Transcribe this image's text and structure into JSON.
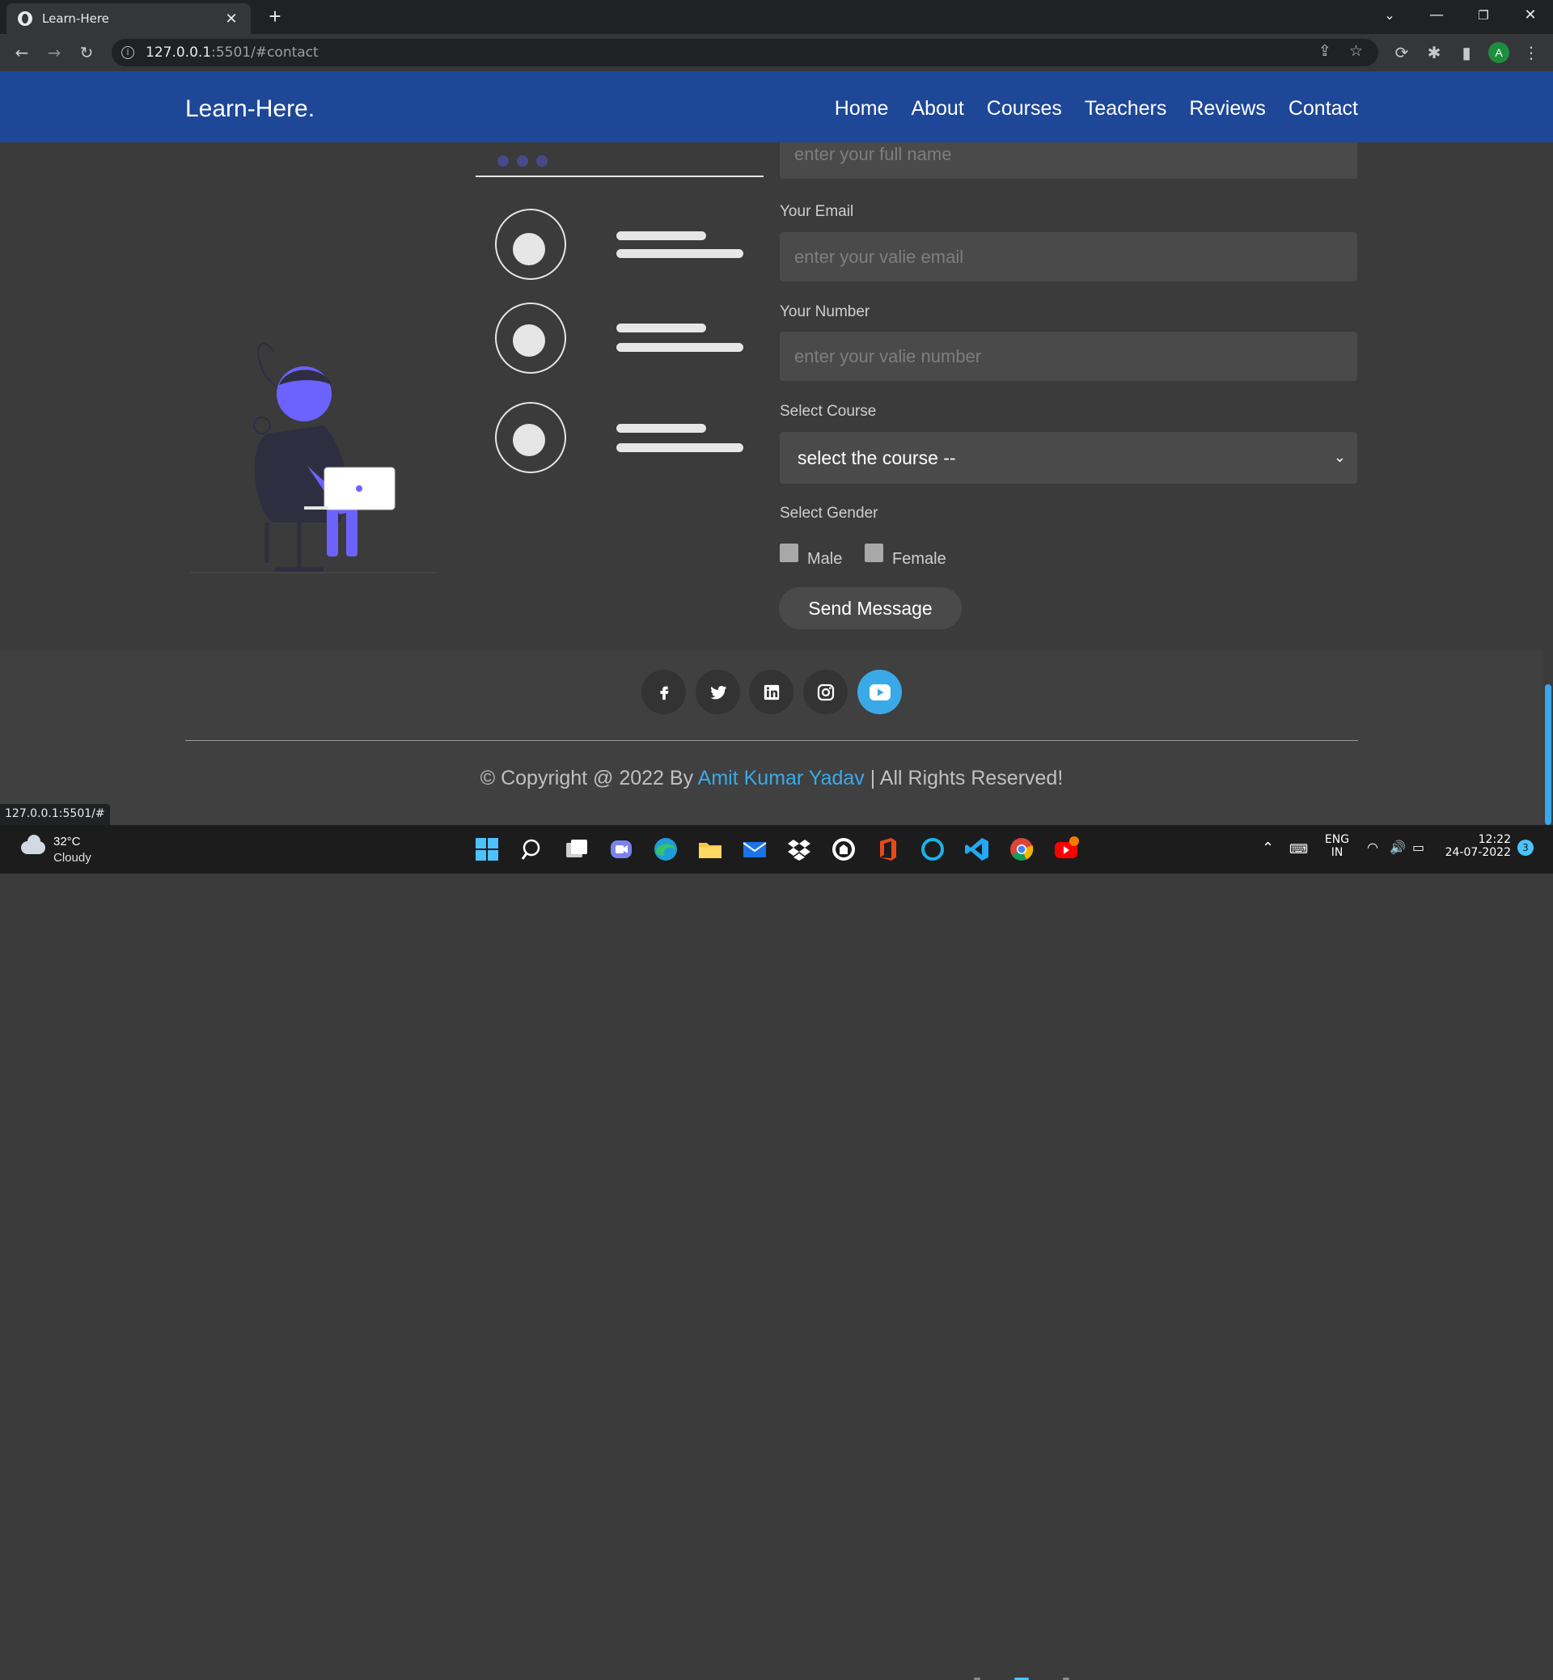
{
  "browser": {
    "tab_title": "Learn-Here",
    "url_host": "127.0.0.1",
    "url_rest": ":5501/#contact",
    "profile_initial": "A",
    "status_url": "127.0.0.1:5501/#"
  },
  "site": {
    "logo": "Learn-Here.",
    "nav": [
      "Home",
      "About",
      "Courses",
      "Teachers",
      "Reviews",
      "Contact"
    ]
  },
  "form": {
    "name_placeholder": "enter your full name",
    "email_label": "Your Email",
    "email_placeholder": "enter your valie email",
    "number_label": "Your Number",
    "number_placeholder": "enter your valie number",
    "course_label": "Select Course",
    "course_value": "select the course --",
    "gender_label": "Select Gender",
    "gender_options": [
      "Male",
      "Female"
    ],
    "submit_label": "Send Message"
  },
  "footer": {
    "social_icons": [
      "facebook-icon",
      "twitter-icon",
      "linkedin-icon",
      "instagram-icon",
      "youtube-icon"
    ],
    "copyright_prefix": "© Copyright @ 2022 By",
    "author": "Amit Kumar Yadav",
    "copyright_suffix": "| All Rights Reserved!"
  },
  "taskbar": {
    "temperature": "32°C",
    "condition": "Cloudy",
    "lang_line1": "ENG",
    "lang_line2": "IN",
    "time": "12:22",
    "date": "24-07-2022",
    "notification_count": "3"
  },
  "colors": {
    "header_bg": "#1e4797",
    "accent": "#3aa9e8",
    "illustration": "#6c63ff"
  }
}
